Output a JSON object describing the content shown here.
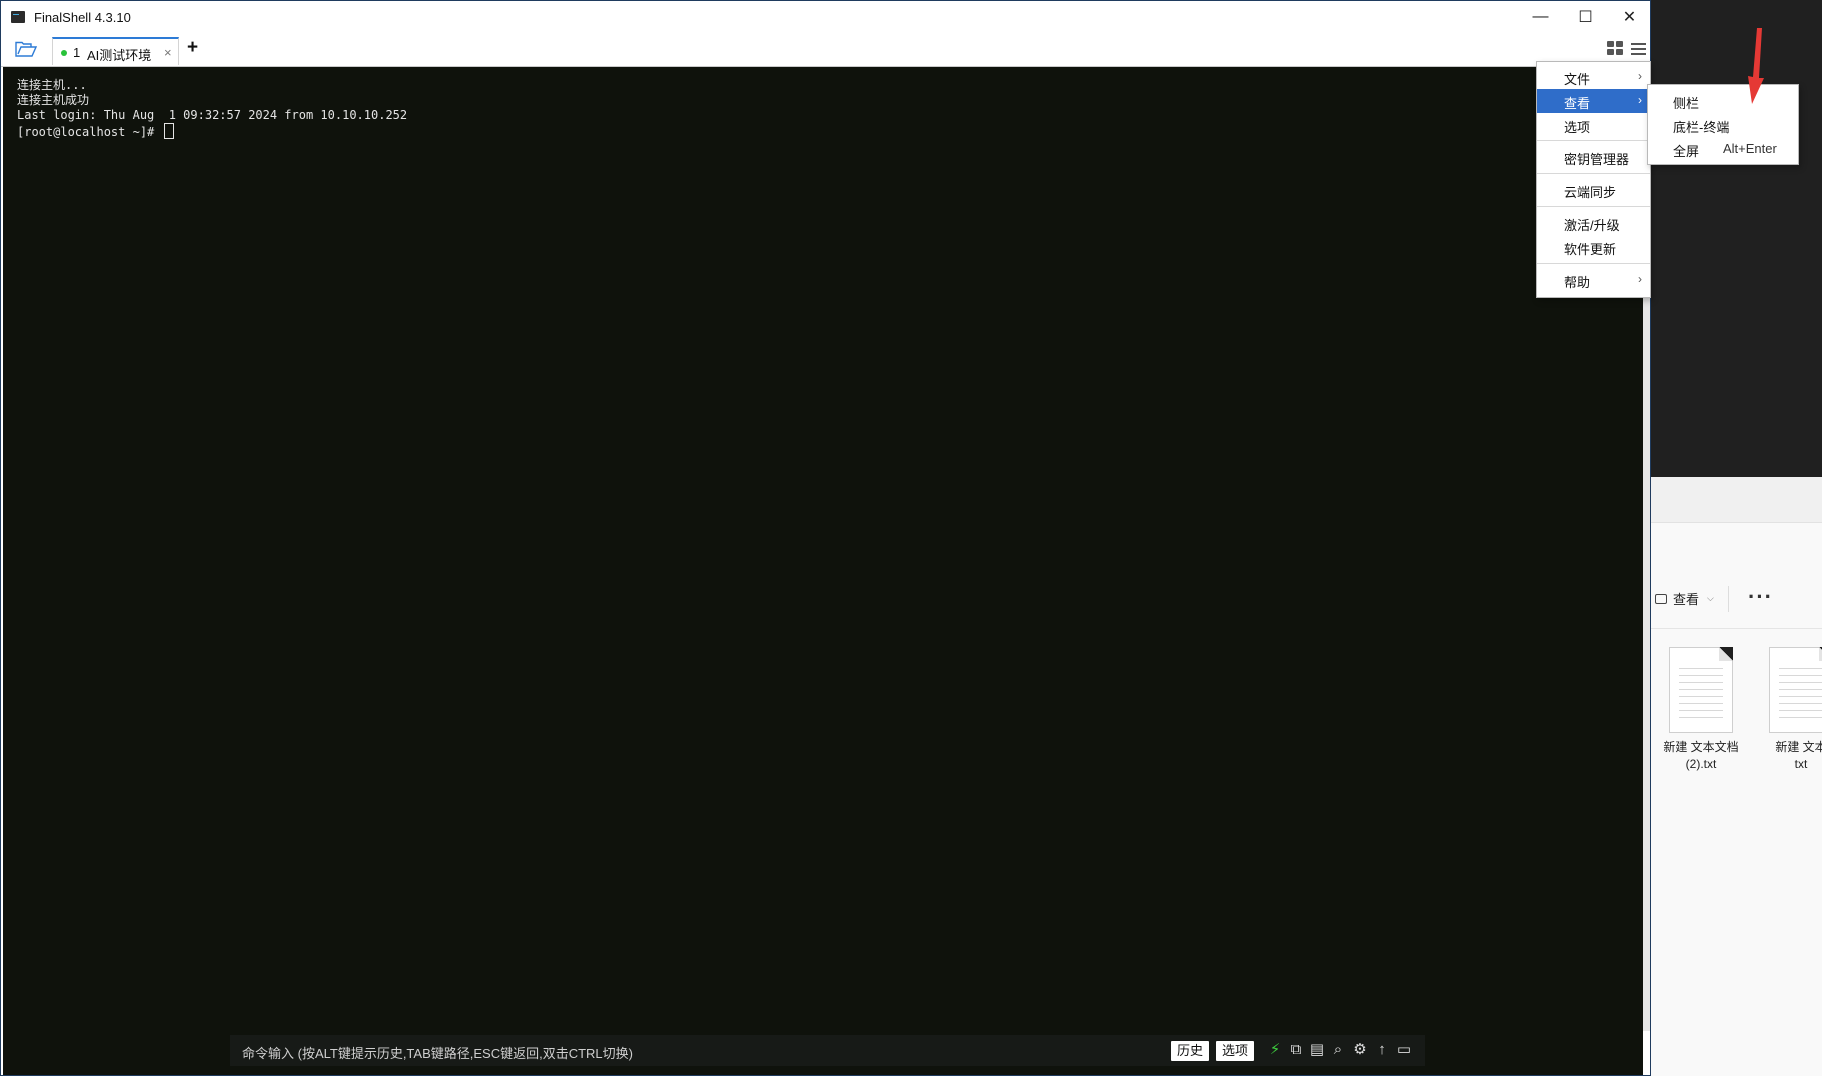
{
  "window": {
    "title": "FinalShell 4.3.10",
    "minimize_label": "—",
    "maximize_label": "☐",
    "close_label": "✕"
  },
  "tab": {
    "number": "1",
    "label": "AI测试环境",
    "close_label": "×",
    "status_color": "#28c23a",
    "add_label": "+"
  },
  "terminal": {
    "lines": [
      "连接主机...",
      "连接主机成功",
      "Last login: Thu Aug  1 09:32:57 2024 from 10.10.10.252"
    ],
    "prompt": "[root@localhost ~]# "
  },
  "command_bar": {
    "hint": "命令输入 (按ALT键提示历史,TAB键路径,ESC键返回,双击CTRL切换)",
    "history_label": "历史",
    "options_label": "选项",
    "icons": [
      "lightning-icon",
      "copy-icon",
      "paste-icon",
      "search-icon",
      "gear-icon",
      "upload-icon",
      "window-icon"
    ]
  },
  "main_menu": {
    "items": [
      {
        "label": "文件",
        "has_submenu": true
      },
      {
        "label": "查看",
        "has_submenu": true,
        "active": true
      },
      {
        "label": "选项"
      },
      {
        "label": "密钥管理器"
      },
      {
        "label": "云端同步"
      },
      {
        "label": "激活/升级"
      },
      {
        "label": "软件更新"
      },
      {
        "label": "帮助",
        "has_submenu": true
      }
    ]
  },
  "view_submenu": {
    "items": [
      {
        "label": "侧栏",
        "shortcut": ""
      },
      {
        "label": "底栏-终端",
        "shortcut": ""
      },
      {
        "label": "全屏",
        "shortcut": "Alt+Enter"
      }
    ]
  },
  "background_explorer": {
    "view_label": "查看",
    "more_label": "···",
    "files": [
      {
        "name_line1": "新建 文本文档",
        "name_line2": "(2).txt"
      },
      {
        "name_line1": "新建 文本",
        "name_line2": "txt"
      }
    ]
  },
  "colors": {
    "accent": "#2f6dc9",
    "terminal_bg": "#0f120c",
    "annotation_arrow": "#e53935"
  }
}
